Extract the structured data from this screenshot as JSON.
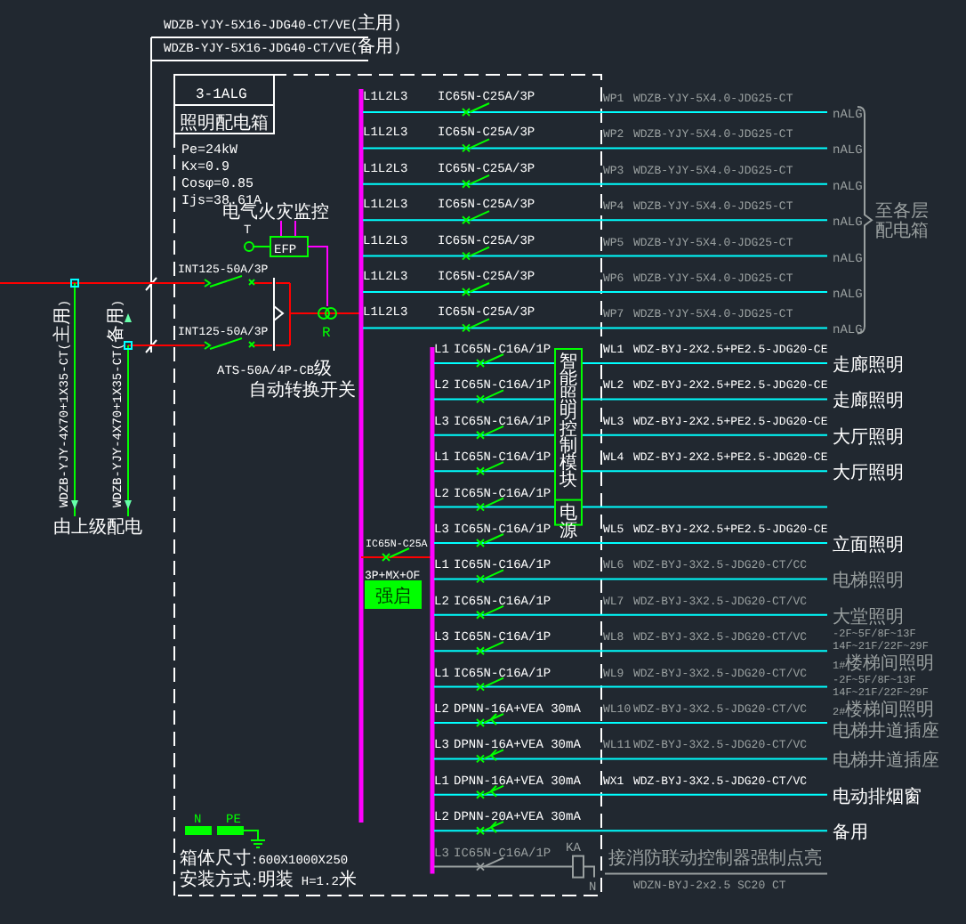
{
  "feeder_cables": [
    "WDZB-YJY-5X16-JDG40-CT/VE(主用)",
    "WDZB-YJY-5X16-JDG40-CT/VE(备用)"
  ],
  "incoming_cables": [
    "WDZB-YJY-4X70+1X35-CT(主用)",
    "WDZB-YJY-4X70+1X35-CT(备用)"
  ],
  "incoming_note": "由上级配电",
  "panel": {
    "name": "3-1ALG",
    "subtitle": "照明配电箱",
    "parameters": [
      "Pe=24kW",
      "Kx=0.9",
      "Cosφ=0.85",
      "Ijs=38.61A"
    ],
    "size": "箱体尺寸:600X1000X250",
    "installation": "安装方式:明装 H=1.2米"
  },
  "fire_monitor": {
    "note": "电气火灾监控",
    "module": "EFP",
    "sensor": "T",
    "transformer": "R"
  },
  "input_switches": [
    "INT125-50A/3P",
    "INT125-50A/3P"
  ],
  "ats": {
    "model": "ATS-50A/4P-CB级",
    "name": "自动转换开关"
  },
  "power_circuits": [
    {
      "phase": "L1L2L3",
      "breaker": "IC65N-C25A/3P",
      "circuit": "WP1",
      "cable": "WDZB-YJY-5X4.0-JDG25-CT",
      "load": "nALG"
    },
    {
      "phase": "L1L2L3",
      "breaker": "IC65N-C25A/3P",
      "circuit": "WP2",
      "cable": "WDZB-YJY-5X4.0-JDG25-CT",
      "load": "nALG"
    },
    {
      "phase": "L1L2L3",
      "breaker": "IC65N-C25A/3P",
      "circuit": "WP3",
      "cable": "WDZB-YJY-5X4.0-JDG25-CT",
      "load": "nALG"
    },
    {
      "phase": "L1L2L3",
      "breaker": "IC65N-C25A/3P",
      "circuit": "WP4",
      "cable": "WDZB-YJY-5X4.0-JDG25-CT",
      "load": "nALG"
    },
    {
      "phase": "L1L2L3",
      "breaker": "IC65N-C25A/3P",
      "circuit": "WP5",
      "cable": "WDZB-YJY-5X4.0-JDG25-CT",
      "load": "nALG"
    },
    {
      "phase": "L1L2L3",
      "breaker": "IC65N-C25A/3P",
      "circuit": "WP6",
      "cable": "WDZB-YJY-5X4.0-JDG25-CT",
      "load": "nALG"
    },
    {
      "phase": "L1L2L3",
      "breaker": "IC65N-C25A/3P",
      "circuit": "WP7",
      "cable": "WDZB-YJY-5X4.0-JDG25-CT",
      "load": "nALG"
    }
  ],
  "power_group_label": [
    "至各层",
    "配电箱"
  ],
  "main_breaker": {
    "model": "IC65N-C25A",
    "accessories": "3P+MX+OF",
    "tag": "强启"
  },
  "control_module": {
    "name": "智能照明控制模块",
    "power": "电源"
  },
  "lighting_circuits": [
    {
      "kind": "breaker",
      "phase": "L1",
      "breaker": "IC65N-C16A/1P",
      "circuit": "WL1",
      "cable": "WDZ-BYJ-2X2.5+PE2.5-JDG20-CE",
      "dimmed": false,
      "load": [
        "走廊照明"
      ]
    },
    {
      "kind": "breaker",
      "phase": "L2",
      "breaker": "IC65N-C16A/1P",
      "circuit": "WL2",
      "cable": "WDZ-BYJ-2X2.5+PE2.5-JDG20-CE",
      "dimmed": false,
      "load": [
        "走廊照明"
      ]
    },
    {
      "kind": "breaker",
      "phase": "L3",
      "breaker": "IC65N-C16A/1P",
      "circuit": "WL3",
      "cable": "WDZ-BYJ-2X2.5+PE2.5-JDG20-CE",
      "dimmed": false,
      "load": [
        "大厅照明"
      ]
    },
    {
      "kind": "breaker",
      "phase": "L1",
      "breaker": "IC65N-C16A/1P",
      "circuit": "WL4",
      "cable": "WDZ-BYJ-2X2.5+PE2.5-JDG20-CE",
      "dimmed": false,
      "load": [
        "大厅照明"
      ]
    },
    {
      "kind": "breaker",
      "phase": "L2",
      "breaker": "IC65N-C16A/1P"
    },
    {
      "kind": "breaker",
      "phase": "L3",
      "breaker": "IC65N-C16A/1P",
      "circuit": "WL5",
      "cable": "WDZ-BYJ-2X2.5+PE2.5-JDG20-CE",
      "dimmed": false,
      "load": [
        "立面照明"
      ]
    },
    {
      "kind": "breaker",
      "phase": "L1",
      "breaker": "IC65N-C16A/1P",
      "circuit": "WL6",
      "cable": "WDZ-BYJ-3X2.5-JDG20-CT/CC",
      "dimmed": true,
      "load": [
        "电梯照明"
      ]
    },
    {
      "kind": "breaker",
      "phase": "L2",
      "breaker": "IC65N-C16A/1P",
      "circuit": "WL7",
      "cable": "WDZ-BYJ-3X2.5-JDG20-CT/VC",
      "dimmed": true,
      "load": [
        "大堂照明"
      ]
    },
    {
      "kind": "breaker",
      "phase": "L3",
      "breaker": "IC65N-C16A/1P",
      "circuit": "WL8",
      "cable": "WDZ-BYJ-3X2.5-JDG20-CT/VC",
      "dimmed": true,
      "load": [
        "-2F~5F/8F~13F",
        "14F~21F/22F~29F",
        "1#楼梯间照明"
      ]
    },
    {
      "kind": "breaker",
      "phase": "L1",
      "breaker": "IC65N-C16A/1P",
      "circuit": "WL9",
      "cable": "WDZ-BYJ-3X2.5-JDG20-CT/VC",
      "dimmed": true,
      "load": [
        "-2F~5F/8F~13F",
        "14F~21F/22F~29F",
        "2#楼梯间照明"
      ]
    },
    {
      "kind": "rcd",
      "phase": "L2",
      "breaker": "DPNN-16A+VEA 30mA",
      "circuit": "WL10",
      "cable": "WDZ-BYJ-3X2.5-JDG20-CT/VC",
      "dimmed": true,
      "load": [
        "电梯井道插座"
      ]
    },
    {
      "kind": "rcd",
      "phase": "L3",
      "breaker": "DPNN-16A+VEA 30mA",
      "circuit": "WL11",
      "cable": "WDZ-BYJ-3X2.5-JDG20-CT/VC",
      "dimmed": true,
      "load": [
        "电梯井道插座"
      ]
    },
    {
      "kind": "rcd",
      "phase": "L1",
      "breaker": "DPNN-16A+VEA 30mA",
      "circuit": "WX1",
      "cable": "WDZ-BYJ-3X2.5-JDG20-CT/VC",
      "dimmed": false,
      "load": [
        "电动排烟窗"
      ]
    },
    {
      "kind": "rcd",
      "phase": "L2",
      "breaker": "DPNN-20A+VEA 30mA",
      "dimmed": false,
      "load": [
        "备用"
      ]
    },
    {
      "kind": "contactor",
      "phase": "L3",
      "breaker": "IC65N-C16A/1P",
      "relay": "KA",
      "neutral": "N",
      "note": "接消防联动控制器强制点亮",
      "cable": "WDZN-BYJ-2x2.5 SC20 CT",
      "dimmed": true
    }
  ],
  "terminals": [
    "N",
    "PE"
  ]
}
